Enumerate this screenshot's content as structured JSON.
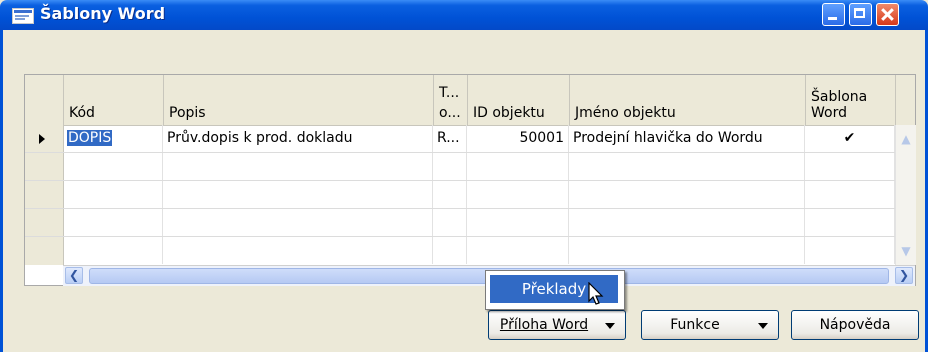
{
  "window": {
    "title": "Šablony Word"
  },
  "grid": {
    "columns": [
      {
        "label1": "",
        "label2": "Kód"
      },
      {
        "label1": "",
        "label2": "Popis"
      },
      {
        "label1": "T...",
        "label2": "o..."
      },
      {
        "label1": "",
        "label2": "ID objektu"
      },
      {
        "label1": "",
        "label2": "Jméno objektu"
      },
      {
        "label1": "Šablona",
        "label2": "Word"
      }
    ],
    "rows": [
      {
        "kod": "DOPIS",
        "popis": "Prův.dopis k prod. dokladu",
        "typ": "R...",
        "id": "50001",
        "jmeno": "Prodejní hlavička do Wordu",
        "sablona": "✔"
      }
    ]
  },
  "buttons": {
    "priloha": "Příloha Word",
    "funkce": "Funkce",
    "napoveda": "Nápověda"
  },
  "menu": {
    "item": "Překlady"
  }
}
